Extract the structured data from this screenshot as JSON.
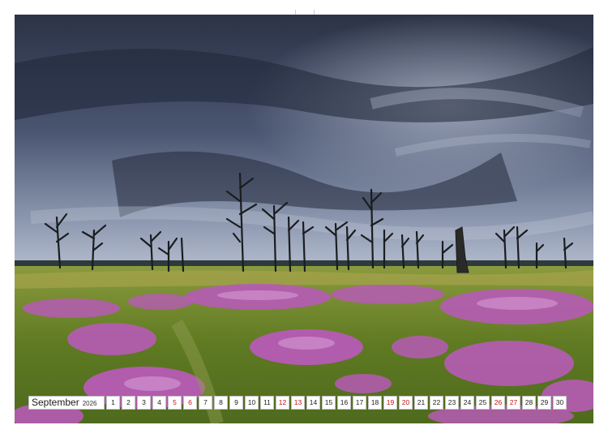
{
  "calendar": {
    "month": "September",
    "year": "2026",
    "days": [
      {
        "n": "1",
        "weekend": false
      },
      {
        "n": "2",
        "weekend": false
      },
      {
        "n": "3",
        "weekend": false
      },
      {
        "n": "4",
        "weekend": false
      },
      {
        "n": "5",
        "weekend": true
      },
      {
        "n": "6",
        "weekend": true
      },
      {
        "n": "7",
        "weekend": false
      },
      {
        "n": "8",
        "weekend": false
      },
      {
        "n": "9",
        "weekend": false
      },
      {
        "n": "10",
        "weekend": false
      },
      {
        "n": "11",
        "weekend": false
      },
      {
        "n": "12",
        "weekend": true
      },
      {
        "n": "13",
        "weekend": true
      },
      {
        "n": "14",
        "weekend": false
      },
      {
        "n": "15",
        "weekend": false
      },
      {
        "n": "16",
        "weekend": false
      },
      {
        "n": "17",
        "weekend": false
      },
      {
        "n": "18",
        "weekend": false
      },
      {
        "n": "19",
        "weekend": true
      },
      {
        "n": "20",
        "weekend": true
      },
      {
        "n": "21",
        "weekend": false
      },
      {
        "n": "22",
        "weekend": false
      },
      {
        "n": "23",
        "weekend": false
      },
      {
        "n": "24",
        "weekend": false
      },
      {
        "n": "25",
        "weekend": false
      },
      {
        "n": "26",
        "weekend": true
      },
      {
        "n": "27",
        "weekend": true
      },
      {
        "n": "28",
        "weekend": false
      },
      {
        "n": "29",
        "weekend": false
      },
      {
        "n": "30",
        "weekend": false
      }
    ]
  },
  "colors": {
    "sky_dark": "#2c3347",
    "sky_light": "#a9b3c7",
    "heather": "#b65bb5",
    "grass": "#6f8a2c",
    "weekend_red": "#c0141c"
  },
  "photo": {
    "subject_icons": [
      "dead-tree-icon",
      "heather-icon",
      "storm-cloud-icon"
    ]
  }
}
